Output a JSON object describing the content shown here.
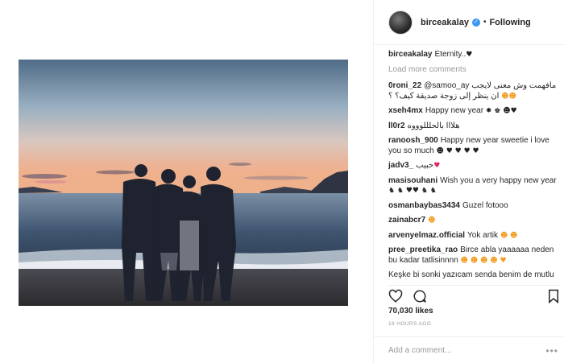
{
  "header": {
    "username": "birceakalay",
    "separator": "•",
    "follow_label": "Following"
  },
  "caption": {
    "username": "birceakalay",
    "text": "Eternity.."
  },
  "load_more": "Load more comments",
  "comments": [
    {
      "username": "0roni_22",
      "text": "@samoo_ay ﻣﺎﻓﻬﻤﺖ ﻭﺵ ﻣﻌﻨﻰ ﻻﻳﺠﺐ ﺍﻥ ﻳﻨﻈﺮ ﺇﻟﻰ ﺯﻭﺟﺔ ﺻﺪﻳﻘﺔ ﻛﻴﻒ؟ ؟"
    },
    {
      "username": "xseh4mx",
      "text": "Happy new year"
    },
    {
      "username": "ll0r2",
      "text": "ﻫﻼﺍﺍ ﺑﺎﻟﺤﻠﻠﻠﻮﻭﻭﻩ"
    },
    {
      "username": "ranoosh_900",
      "text": "Happy new year sweetie i love you so much"
    },
    {
      "username": "jadv3_",
      "text": "ﺣﺒﻴﺐ"
    },
    {
      "username": "masisouhani",
      "text": "Wish you a very happy new year"
    },
    {
      "username": "osmanbaybas3434",
      "text": "Guzel fotooo"
    },
    {
      "username": "zainabcr7",
      "text": ""
    },
    {
      "username": "arvenyelmaz.official",
      "text": "Yok artik"
    },
    {
      "username": "pree_preetika_rao",
      "text": "Birce abla yaaaaaa neden bu kadar tatlisinnnn"
    },
    {
      "username": "",
      "text": "Keşke bi sonki yazıcam senda benim de mutlu"
    }
  ],
  "emoji": {
    "caption_heart": "♥",
    "c0_faces": "☻☻",
    "c1": "✸ ♚ ☻♥",
    "c3": "☻ ♥ ♥ ♥ ♥",
    "c4": "♥",
    "c5": "♞ ♞ ♥♥ ♞ ♞",
    "c6": "☻",
    "c7": "☻",
    "c8": "☻ ☻",
    "c9": "☻ ☻ ☻ ☻ ♥"
  },
  "stats": {
    "likes": "70,030 likes",
    "time": "18 HOURS AGO"
  },
  "add_comment": {
    "placeholder": "Add a comment...",
    "more": "•••"
  },
  "colors": {
    "verified": "#3897f0",
    "muted": "#999999",
    "text": "#262626",
    "border": "#efefef"
  }
}
